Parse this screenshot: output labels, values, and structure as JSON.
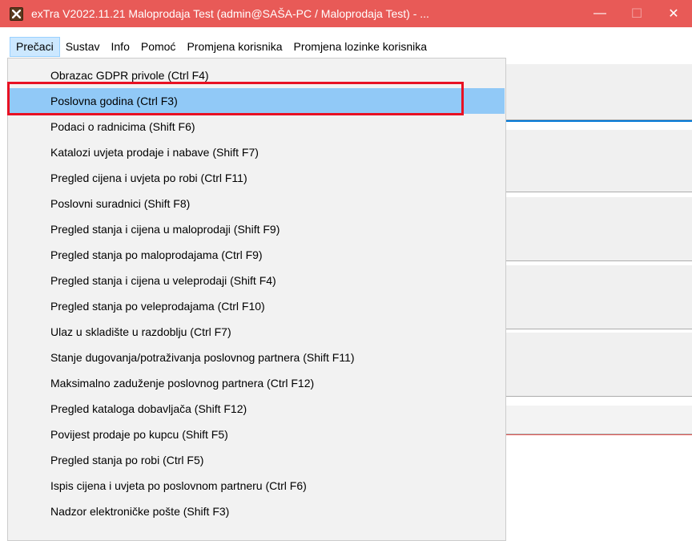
{
  "window": {
    "title": "exTra V2022.11.21 Maloprodaja Test (admin@SAŠA-PC / Maloprodaja Test) - ...",
    "minimize_glyph": "—",
    "maximize_glyph": "☐",
    "close_glyph": "✕",
    "titlebar_color": "#e85a57"
  },
  "menubar": {
    "items": [
      {
        "label": "Prečaci"
      },
      {
        "label": "Sustav"
      },
      {
        "label": "Info"
      },
      {
        "label": "Pomoć"
      },
      {
        "label": "Promjena korisnika"
      },
      {
        "label": "Promjena lozinke korisnika"
      }
    ]
  },
  "dropdown": {
    "highlight_color": "#91c9f7",
    "annotation_color": "#e81123",
    "items": [
      {
        "label": "Obrazac GDPR privole (Ctrl F4)"
      },
      {
        "label": "Poslovna godina (Ctrl F3)"
      },
      {
        "label": "Podaci o radnicima (Shift F6)"
      },
      {
        "label": "Katalozi uvjeta prodaje i nabave (Shift F7)"
      },
      {
        "label": "Pregled cijena i uvjeta po robi (Ctrl F11)"
      },
      {
        "label": "Poslovni suradnici (Shift F8)"
      },
      {
        "label": "Pregled stanja i cijena u maloprodaji (Shift F9)"
      },
      {
        "label": "Pregled stanja po maloprodajama (Ctrl F9)"
      },
      {
        "label": "Pregled stanja i cijena u veleprodaji (Shift F4)"
      },
      {
        "label": "Pregled stanja po veleprodajama (Ctrl F10)"
      },
      {
        "label": "Ulaz u skladište u razdoblju (Ctrl F7)"
      },
      {
        "label": "Stanje dugovanja/potraživanja poslovnog partnera (Shift F11)"
      },
      {
        "label": "Maksimalno zaduženje poslovnog partnera (Ctrl F12)"
      },
      {
        "label": "Pregled kataloga dobavljača (Shift F12)"
      },
      {
        "label": "Povijest prodaje po kupcu (Shift F5)"
      },
      {
        "label": "Pregled stanja po robi (Ctrl F5)"
      },
      {
        "label": "Ispis cijena i uvjeta po poslovnom partneru (Ctrl F6)"
      },
      {
        "label": "Nadzor elektroničke pošte (Shift F3)"
      }
    ]
  }
}
